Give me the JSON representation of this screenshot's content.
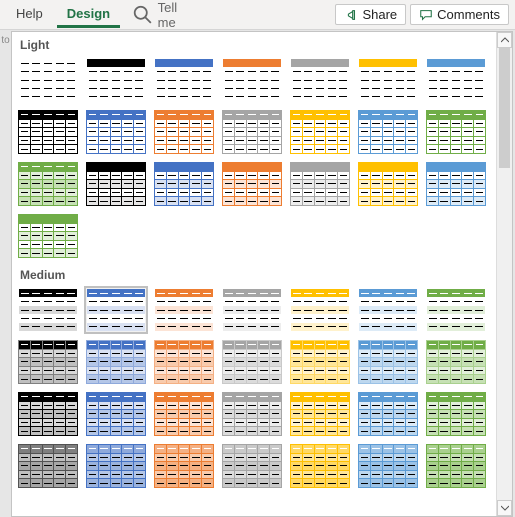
{
  "ribbon": {
    "tabs": [
      {
        "label": "Help"
      },
      {
        "label": "Design"
      }
    ],
    "active_tab_index": 1,
    "tell_me": "Tell me",
    "share": "Share",
    "comments": "Comments"
  },
  "left_stub": "to",
  "gallery": {
    "sections": [
      {
        "label": "Light",
        "rows": [
          [
            {
              "header": "none",
              "body": "none",
              "grid": "dash",
              "sep": "none"
            },
            {
              "header": "#000",
              "body": "none",
              "grid": "dash",
              "sep": "dark"
            },
            {
              "header": "#4472c4",
              "body": "none",
              "grid": "dash",
              "sep": "blue"
            },
            {
              "header": "#ed7d31",
              "body": "none",
              "grid": "dash",
              "sep": "orange"
            },
            {
              "header": "#a5a5a5",
              "body": "none",
              "grid": "dash",
              "sep": "gray"
            },
            {
              "header": "#ffc000",
              "body": "none",
              "grid": "dash",
              "sep": "yellow"
            },
            {
              "header": "#5b9bd5",
              "body": "none",
              "grid": "dash",
              "sep": "blue2"
            }
          ],
          [
            {
              "header": "#000",
              "headerDark": true,
              "body": "#fff",
              "grid": "solid",
              "border": "#000"
            },
            {
              "header": "#4472c4",
              "headerDark": true,
              "body": "#fff",
              "grid": "solid",
              "border": "#4472c4"
            },
            {
              "header": "#ed7d31",
              "headerDark": true,
              "body": "#fff",
              "grid": "solid",
              "border": "#ed7d31"
            },
            {
              "header": "#a5a5a5",
              "headerDark": true,
              "body": "#fff",
              "grid": "solid",
              "border": "#a5a5a5"
            },
            {
              "header": "#ffc000",
              "headerDark": true,
              "body": "#fff",
              "grid": "solid",
              "border": "#ffc000"
            },
            {
              "header": "#5b9bd5",
              "headerDark": true,
              "body": "#fff",
              "grid": "solid",
              "border": "#5b9bd5"
            },
            {
              "header": "#70ad47",
              "headerDark": true,
              "body": "#fff",
              "grid": "solid",
              "border": "#70ad47"
            }
          ],
          [
            {
              "header": "#70ad47",
              "headerDark": true,
              "body": "#e2efda",
              "grid": "solid",
              "border": "#70ad47",
              "banded": "#c6e0b4"
            },
            {
              "header": "#000",
              "body": "#fff",
              "grid": "solid",
              "border": "#000",
              "banded": "#e7e6e6"
            },
            {
              "header": "#4472c4",
              "body": "#fff",
              "grid": "solid",
              "border": "#4472c4",
              "banded": "#d9e1f2"
            },
            {
              "header": "#ed7d31",
              "body": "#fff",
              "grid": "solid",
              "border": "#ed7d31",
              "banded": "#fce4d6"
            },
            {
              "header": "#a5a5a5",
              "body": "#fff",
              "grid": "solid",
              "border": "#a5a5a5",
              "banded": "#ededed"
            },
            {
              "header": "#ffc000",
              "body": "#fff",
              "grid": "solid",
              "border": "#ffc000",
              "banded": "#fff2cc"
            },
            {
              "header": "#5b9bd5",
              "body": "#fff",
              "grid": "solid",
              "border": "#5b9bd5",
              "banded": "#ddebf7"
            }
          ],
          [
            {
              "header": "#70ad47",
              "body": "#fff",
              "grid": "solid",
              "border": "#70ad47",
              "banded": "#e2efda"
            }
          ]
        ]
      },
      {
        "label": "Medium",
        "rows": [
          [
            {
              "header": "#000",
              "headerDark": true,
              "body": "#fff",
              "banded": "#d9d9d9",
              "grid": "dash"
            },
            {
              "header": "#4472c4",
              "headerDark": true,
              "body": "#fff",
              "banded": "#d9e1f2",
              "grid": "dash",
              "selected": true
            },
            {
              "header": "#ed7d31",
              "headerDark": true,
              "body": "#fff",
              "banded": "#fce4d6",
              "grid": "dash"
            },
            {
              "header": "#a5a5a5",
              "headerDark": true,
              "body": "#fff",
              "banded": "#ededed",
              "grid": "dash"
            },
            {
              "header": "#ffc000",
              "headerDark": true,
              "body": "#fff",
              "banded": "#fff2cc",
              "grid": "dash"
            },
            {
              "header": "#5b9bd5",
              "headerDark": true,
              "body": "#fff",
              "banded": "#ddebf7",
              "grid": "dash"
            },
            {
              "header": "#70ad47",
              "headerDark": true,
              "body": "#fff",
              "banded": "#e2efda",
              "grid": "dash"
            }
          ],
          [
            {
              "header": "#000",
              "headerDark": true,
              "body": "#d9d9d9",
              "banded": "#bfbfbf",
              "grid": "solid",
              "border": "#7f7f7f"
            },
            {
              "header": "#4472c4",
              "headerDark": true,
              "body": "#d9e1f2",
              "banded": "#b4c6e7",
              "grid": "solid",
              "border": "#8ea9db"
            },
            {
              "header": "#ed7d31",
              "headerDark": true,
              "body": "#fce4d6",
              "banded": "#f8cbad",
              "grid": "solid",
              "border": "#f4b084"
            },
            {
              "header": "#a5a5a5",
              "headerDark": true,
              "body": "#ededed",
              "banded": "#dbdbdb",
              "grid": "solid",
              "border": "#c9c9c9"
            },
            {
              "header": "#ffc000",
              "headerDark": true,
              "body": "#fff2cc",
              "banded": "#ffe699",
              "grid": "solid",
              "border": "#ffd966"
            },
            {
              "header": "#5b9bd5",
              "headerDark": true,
              "body": "#ddebf7",
              "banded": "#bdd7ee",
              "grid": "solid",
              "border": "#9bc2e6"
            },
            {
              "header": "#70ad47",
              "headerDark": true,
              "body": "#e2efda",
              "banded": "#c6e0b4",
              "grid": "solid",
              "border": "#a9d08e"
            }
          ],
          [
            {
              "header": "#000",
              "headerDark": true,
              "body": "#d9d9d9",
              "grid": "solid",
              "border": "#000",
              "banded": "#bfbfbf",
              "thick": true
            },
            {
              "header": "#4472c4",
              "headerDark": true,
              "body": "#d9e1f2",
              "grid": "solid",
              "border": "#4472c4",
              "banded": "#b4c6e7",
              "thick": true
            },
            {
              "header": "#ed7d31",
              "headerDark": true,
              "body": "#fce4d6",
              "grid": "solid",
              "border": "#ed7d31",
              "banded": "#f8cbad",
              "thick": true
            },
            {
              "header": "#a5a5a5",
              "headerDark": true,
              "body": "#ededed",
              "grid": "solid",
              "border": "#a5a5a5",
              "banded": "#dbdbdb",
              "thick": true
            },
            {
              "header": "#ffc000",
              "headerDark": true,
              "body": "#fff2cc",
              "grid": "solid",
              "border": "#ffc000",
              "banded": "#ffe699",
              "thick": true
            },
            {
              "header": "#5b9bd5",
              "headerDark": true,
              "body": "#ddebf7",
              "grid": "solid",
              "border": "#5b9bd5",
              "banded": "#bdd7ee",
              "thick": true
            },
            {
              "header": "#70ad47",
              "headerDark": true,
              "body": "#e2efda",
              "grid": "solid",
              "border": "#70ad47",
              "banded": "#c6e0b4",
              "thick": true
            }
          ],
          [
            {
              "header": "#7f7f7f",
              "headerDark": true,
              "body": "#bfbfbf",
              "banded": "#a6a6a6",
              "grid": "solid",
              "border": "#525252"
            },
            {
              "header": "#8ea9db",
              "headerDark": true,
              "body": "#b4c6e7",
              "banded": "#9bb3dd",
              "grid": "solid",
              "border": "#4472c4"
            },
            {
              "header": "#f4b084",
              "headerDark": true,
              "body": "#f8cbad",
              "banded": "#f4b183",
              "grid": "solid",
              "border": "#ed7d31"
            },
            {
              "header": "#c9c9c9",
              "headerDark": true,
              "body": "#dbdbdb",
              "banded": "#c9c9c9",
              "grid": "solid",
              "border": "#a5a5a5"
            },
            {
              "header": "#ffd966",
              "headerDark": true,
              "body": "#ffe699",
              "banded": "#ffd966",
              "grid": "solid",
              "border": "#ffc000"
            },
            {
              "header": "#9bc2e6",
              "headerDark": true,
              "body": "#bdd7ee",
              "banded": "#9bc2e6",
              "grid": "solid",
              "border": "#5b9bd5"
            },
            {
              "header": "#a9d08e",
              "headerDark": true,
              "body": "#c6e0b4",
              "banded": "#a9d08e",
              "grid": "solid",
              "border": "#70ad47"
            }
          ]
        ]
      }
    ]
  }
}
